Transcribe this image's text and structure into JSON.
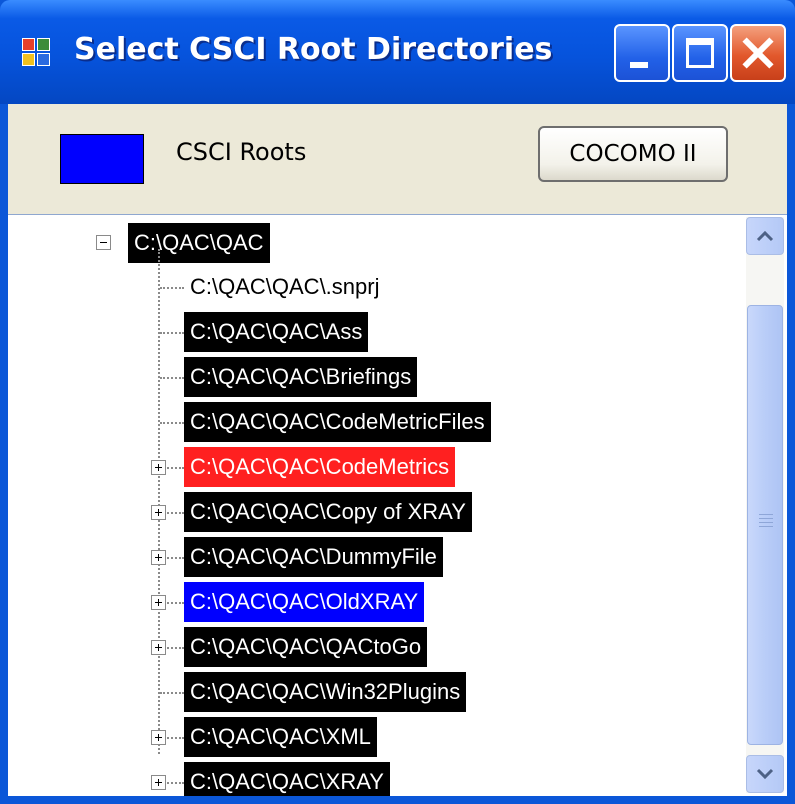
{
  "window": {
    "title": "Select CSCI Root Directories",
    "controls": [
      "minimize",
      "maximize",
      "close"
    ]
  },
  "header": {
    "legend_color": "#0000ff",
    "legend_label": "CSCI Roots",
    "cocomo_button_label": "COCOMO II"
  },
  "tree": {
    "root": {
      "label": "C:\\QAC\\QAC",
      "expanded": true,
      "highlight": "black"
    },
    "children": [
      {
        "label": "C:\\QAC\\QAC\\.snprj",
        "expandable": false,
        "highlight": "none"
      },
      {
        "label": "C:\\QAC\\QAC\\Ass",
        "expandable": false,
        "highlight": "black"
      },
      {
        "label": "C:\\QAC\\QAC\\Briefings",
        "expandable": false,
        "highlight": "black"
      },
      {
        "label": "C:\\QAC\\QAC\\CodeMetricFiles",
        "expandable": false,
        "highlight": "black"
      },
      {
        "label": "C:\\QAC\\QAC\\CodeMetrics",
        "expandable": true,
        "highlight": "red"
      },
      {
        "label": "C:\\QAC\\QAC\\Copy of XRAY",
        "expandable": true,
        "highlight": "black"
      },
      {
        "label": "C:\\QAC\\QAC\\DummyFile",
        "expandable": true,
        "highlight": "black"
      },
      {
        "label": "C:\\QAC\\QAC\\OldXRAY",
        "expandable": true,
        "highlight": "blue"
      },
      {
        "label": "C:\\QAC\\QAC\\QACtoGo",
        "expandable": true,
        "highlight": "black"
      },
      {
        "label": "C:\\QAC\\QAC\\Win32Plugins",
        "expandable": false,
        "highlight": "black"
      },
      {
        "label": "C:\\QAC\\QAC\\XML",
        "expandable": true,
        "highlight": "black"
      },
      {
        "label": "C:\\QAC\\QAC\\XRAY",
        "expandable": true,
        "highlight": "black"
      }
    ]
  },
  "colors": {
    "highlight_black": "#000000",
    "highlight_red": "#ff2020",
    "highlight_blue": "#0000ff"
  }
}
